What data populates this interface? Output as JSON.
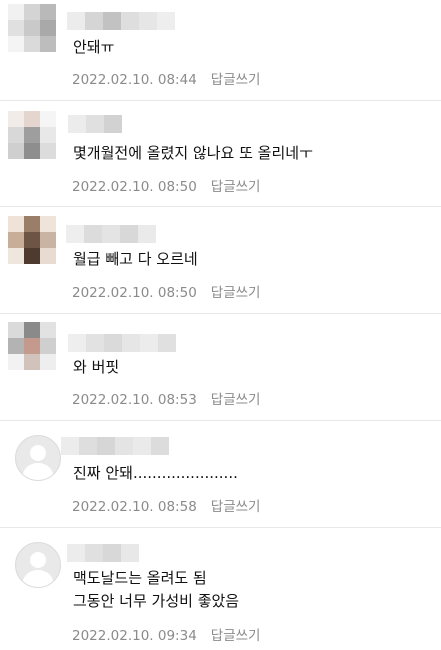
{
  "comments": [
    {
      "text": "안돼ㅠ",
      "date": "2022.02.10. 08:44",
      "reply_label": "답글쓰기"
    },
    {
      "text": "몇개월전에 올렸지 않나요 또 올리네ㅜ",
      "date": "2022.02.10. 08:50",
      "reply_label": "답글쓰기"
    },
    {
      "text": "월급 빼고 다 오르네",
      "date": "2022.02.10. 08:50",
      "reply_label": "답글쓰기"
    },
    {
      "text": "와 버핏",
      "date": "2022.02.10. 08:53",
      "reply_label": "답글쓰기"
    },
    {
      "text": "진짜 안돼......................",
      "date": "2022.02.10. 08:58",
      "reply_label": "답글쓰기"
    },
    {
      "text_lines": [
        "맥도날드는 올려도 됨",
        "그동안 너무 가성비 좋았음"
      ],
      "date": "2022.02.10. 09:34",
      "reply_label": "답글쓰기"
    }
  ],
  "colors": {
    "meta_text": "#8b8b8b",
    "divider": "#e8e8e8",
    "body_text": "#111111"
  },
  "icons": {
    "default_avatar": "person-silhouette-icon"
  }
}
